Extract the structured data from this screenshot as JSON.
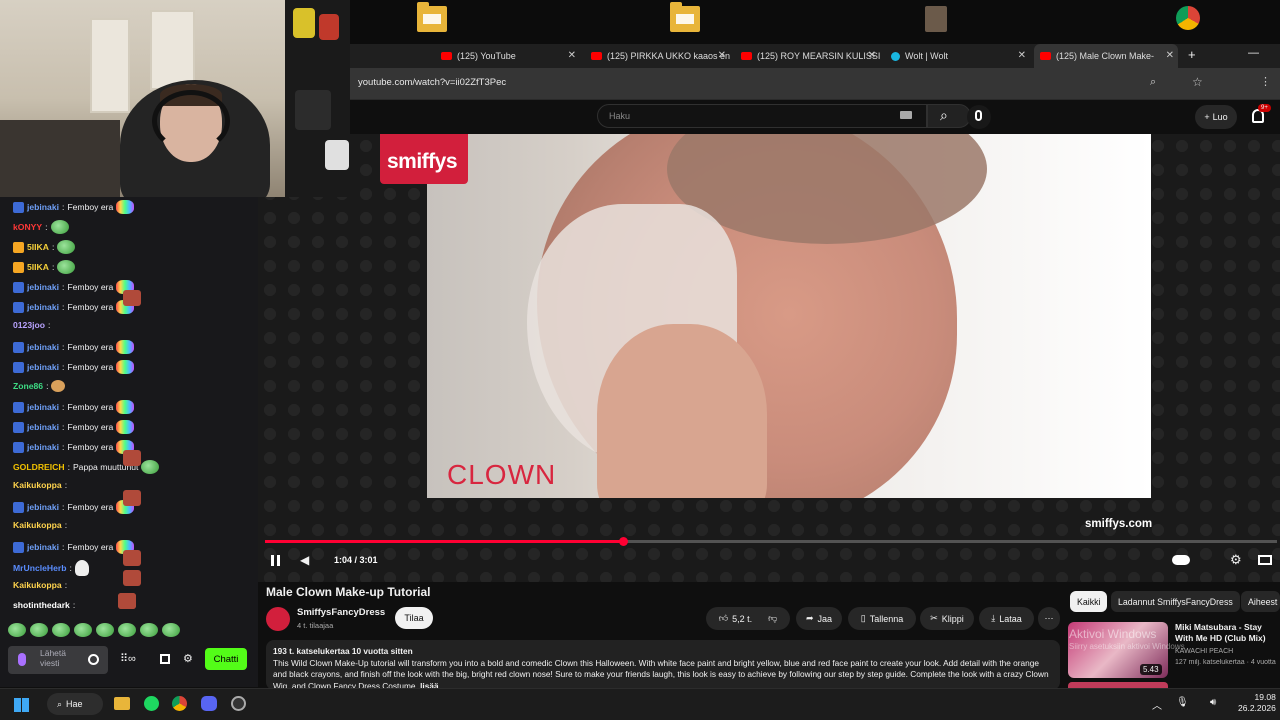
{
  "desktop": {
    "icons": [
      "",
      "",
      "",
      ""
    ]
  },
  "browser": {
    "tabs": [
      {
        "label": "(125) YouTube",
        "icon": "youtube-icon"
      },
      {
        "label": "(125) PIRKKA UKKO kaaos en",
        "icon": "youtube-icon"
      },
      {
        "label": "(125) ROY MEARSIN KULISSI",
        "icon": "youtube-icon"
      },
      {
        "label": "Wolt | Wolt",
        "icon": "wolt-icon"
      },
      {
        "label": "(125) Male Clown Make-",
        "icon": "youtube-icon"
      }
    ],
    "url": "youtube.com/watch?v=ii02ZfT3Pec"
  },
  "youtube": {
    "search_placeholder": "Haku",
    "create_label": "Luo",
    "notification_count": "9+",
    "video": {
      "logo_text": "smiffys",
      "overlay_text": "CLOWN",
      "site_text": "smiffys.com",
      "time": "1:04 / 3:01",
      "progress": 0.354
    },
    "title": "Male Clown Make-up Tutorial",
    "channel": {
      "name": "SmiffysFancyDress",
      "subs": "4 t. tilaajaa",
      "subscribe": "Tilaa"
    },
    "actions": {
      "like": "5,2 t.",
      "share": "Jaa",
      "save": "Tallenna",
      "clip": "Klippi",
      "download": "Lataa"
    },
    "description": {
      "meta": "193 t. katselukertaa  10 vuotta sitten",
      "text": "This Wild Clown Make-Up tutorial will transform you into a bold and comedic Clown this Halloween.  With white face paint and bright yellow, blue and red face paint to create your look. Add detail with the orange and black crayons, and finish off the look with the big, bright red clown nose! Sure to make your friends laugh, this look is easy to achieve by following our step by step guide.  Complete the look with a crazy Clown Wig, and Clown Fancy Dress Costume.",
      "more": "lisää"
    },
    "chips": [
      "Kaikki",
      "Ladannut SmiffysFancyDress",
      "Aiheest"
    ],
    "recommendation": {
      "title": "Miki Matsubara - Stay With Me HD (Club Mix)",
      "channel": "KAWACHI PEACH",
      "views": "127 milj. katselukertaa · 4 vuotta",
      "duration": "5.43"
    },
    "watermark": {
      "line1": "Aktivoi Windows",
      "line2": "Siirry asetuksiin aktivoi Windows"
    }
  },
  "chat": {
    "messages": [
      {
        "user": "jebinaki",
        "color": "#6e9ff7",
        "badge": "#3d6ad6",
        "text": "Femboy era",
        "emote": "rainbow"
      },
      {
        "user": "kONYY",
        "color": "#ff3838",
        "badge": "",
        "text": "",
        "emote": "green"
      },
      {
        "user": "5IIKA",
        "color": "#f5d03a",
        "badge": "#f5a623",
        "text": "",
        "emote": "green"
      },
      {
        "user": "5IIKA",
        "color": "#f5d03a",
        "badge": "#f5a623",
        "text": "",
        "emote": "green"
      },
      {
        "user": "jebinaki",
        "color": "#6e9ff7",
        "badge": "#3d6ad6",
        "text": "Femboy era",
        "emote": "rainbow"
      },
      {
        "user": "jebinaki",
        "color": "#6e9ff7",
        "badge": "#3d6ad6",
        "text": "Femboy era",
        "emote": "rainbow"
      },
      {
        "user": "0123joo",
        "color": "#b9a3ff",
        "badge": "",
        "text": "",
        "emote": "face"
      },
      {
        "user": "jebinaki",
        "color": "#6e9ff7",
        "badge": "#3d6ad6",
        "text": "Femboy era",
        "emote": "rainbow"
      },
      {
        "user": "jebinaki",
        "color": "#6e9ff7",
        "badge": "#3d6ad6",
        "text": "Femboy era",
        "emote": "rainbow"
      },
      {
        "user": "Zone86",
        "color": "#3ddc84",
        "badge": "",
        "text": "",
        "emote": "tan"
      },
      {
        "user": "jebinaki",
        "color": "#6e9ff7",
        "badge": "#3d6ad6",
        "text": "Femboy era",
        "emote": "rainbow"
      },
      {
        "user": "jebinaki",
        "color": "#6e9ff7",
        "badge": "#3d6ad6",
        "text": "Femboy era",
        "emote": "rainbow"
      },
      {
        "user": "jebinaki",
        "color": "#6e9ff7",
        "badge": "#3d6ad6",
        "text": "Femboy era",
        "emote": "rainbow"
      },
      {
        "user": "GOLDREICH",
        "color": "#f2c200",
        "badge": "",
        "text": "Pappa muuttunut",
        "emote": "green"
      },
      {
        "user": "Kaikukoppa",
        "color": "#ffd34d",
        "badge": "",
        "text": "",
        "emote": "face"
      },
      {
        "user": "jebinaki",
        "color": "#6e9ff7",
        "badge": "#3d6ad6",
        "text": "Femboy era",
        "emote": "rainbow"
      },
      {
        "user": "Kaikukoppa",
        "color": "#ffd34d",
        "badge": "",
        "text": "",
        "emote": "face"
      },
      {
        "user": "jebinaki",
        "color": "#6e9ff7",
        "badge": "#3d6ad6",
        "text": "Femboy era",
        "emote": "rainbow"
      },
      {
        "user": "MrUncleHerb",
        "color": "#5a8dff",
        "badge": "",
        "text": "",
        "emote": "ghost"
      },
      {
        "user": "Kaikukoppa",
        "color": "#ffd34d",
        "badge": "",
        "text": "",
        "emote": "face"
      },
      {
        "user": "shotinthedark",
        "color": "#ffffff",
        "badge": "",
        "text": "",
        "emote": "face"
      }
    ],
    "input_placeholder": "Lähetä viesti",
    "send_label": "Chatti"
  },
  "taskbar": {
    "search": "Hae",
    "time": "19.08",
    "date": "26.2.2026"
  }
}
